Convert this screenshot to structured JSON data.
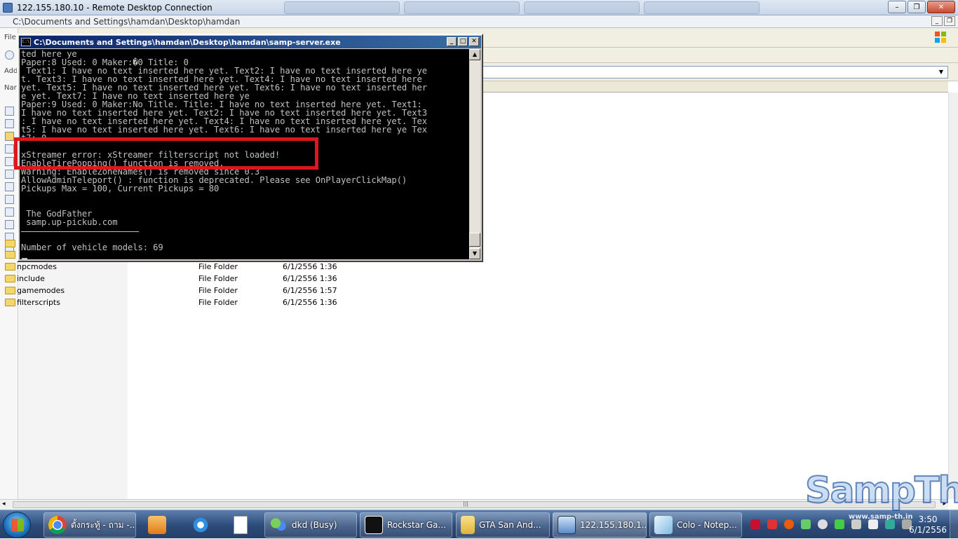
{
  "rdp": {
    "title": "122.155.180.10 - Remote Desktop Connection",
    "minimize": "–",
    "restore": "❐",
    "close": "✕"
  },
  "explorer": {
    "title": "C:\\Documents and Settings\\hamdan\\Desktop\\hamdan",
    "minimize": "_",
    "restore": "❐",
    "menu_fragment": "File",
    "address_fragment": "Add",
    "header_fragment": "Nar",
    "files": [
      {
        "name": "npcmodes",
        "type": "File Folder",
        "date": "6/1/2556 1:36"
      },
      {
        "name": "include",
        "type": "File Folder",
        "date": "6/1/2556 1:36"
      },
      {
        "name": "gamemodes",
        "type": "File Folder",
        "date": "6/1/2556 1:57"
      },
      {
        "name": "filterscripts",
        "type": "File Folder",
        "date": "6/1/2556 1:36"
      }
    ],
    "scroll_left": "◂",
    "scroll_right": "▸",
    "scroll_grip": "|||",
    "dropdown": "▼"
  },
  "console": {
    "title": "C:\\Documents and Settings\\hamdan\\Desktop\\hamdan\\samp-server.exe",
    "icon_label": "C:\\",
    "minimize": "_",
    "maximize": "□",
    "close": "✕",
    "scroll_up": "▲",
    "scroll_down": "▼",
    "lines": [
      "ted here ye",
      "Paper:8 Used: 0 Maker:�0 Title: 0",
      " Text1: I have no text inserted here yet. Text2: I have no text inserted here ye",
      "t. Text3: I have no text inserted here yet. Text4: I have no text inserted here",
      "yet. Text5: I have no text inserted here yet. Text6: I have no text inserted her",
      "e yet. Text7: I have no text inserted here ye",
      "Paper:9 Used: 0 Maker:No Title. Title: I have no text inserted here yet. Text1:",
      "I have no text inserted here yet. Text2: I have no text inserted here yet. Text3",
      ": I have no text inserted here yet. Text4: I have no text inserted here yet. Tex",
      "t5: I have no text inserted here yet. Text6: I have no text inserted here ye Tex",
      "t7: 0",
      "xStreamer error: xStreamer filterscript not loaded!",
      "EnableTirePopping() function is removed.",
      "Warning: EnableZoneNames() is removed since 0.3",
      "AllowAdminTeleport() : function is deprecated. Please see OnPlayerClickMap()",
      "Pickups Max = 100, Current Pickups = 80",
      "",
      "",
      " The GodFather",
      " samp.up-pickub.com",
      "",
      "",
      "Number of vehicle models: 69"
    ]
  },
  "taskbar": {
    "items": [
      {
        "label": "ตั้งกระทู้ - ถาม -...",
        "icon": "chrome-icon"
      },
      {
        "label": "dkd (Busy)",
        "icon": "messenger-icon"
      },
      {
        "label": "Rockstar Ga...",
        "icon": "rockstar-icon"
      },
      {
        "label": "GTA San And...",
        "icon": "folder-icon"
      },
      {
        "label": "122.155.180.1...",
        "icon": "remote-desktop-icon"
      },
      {
        "label": "Colo - Notep...",
        "icon": "notepad-icon"
      }
    ],
    "clock_time": "3:50",
    "clock_date": "6/1/2556"
  },
  "watermark": {
    "text": "SampTh",
    "sub": "www.samp-th.in"
  },
  "colors": {
    "highlight": "#e0161f",
    "console_bg": "#000000",
    "console_fg": "#c0c0c0",
    "console_title": "#0a246a"
  }
}
